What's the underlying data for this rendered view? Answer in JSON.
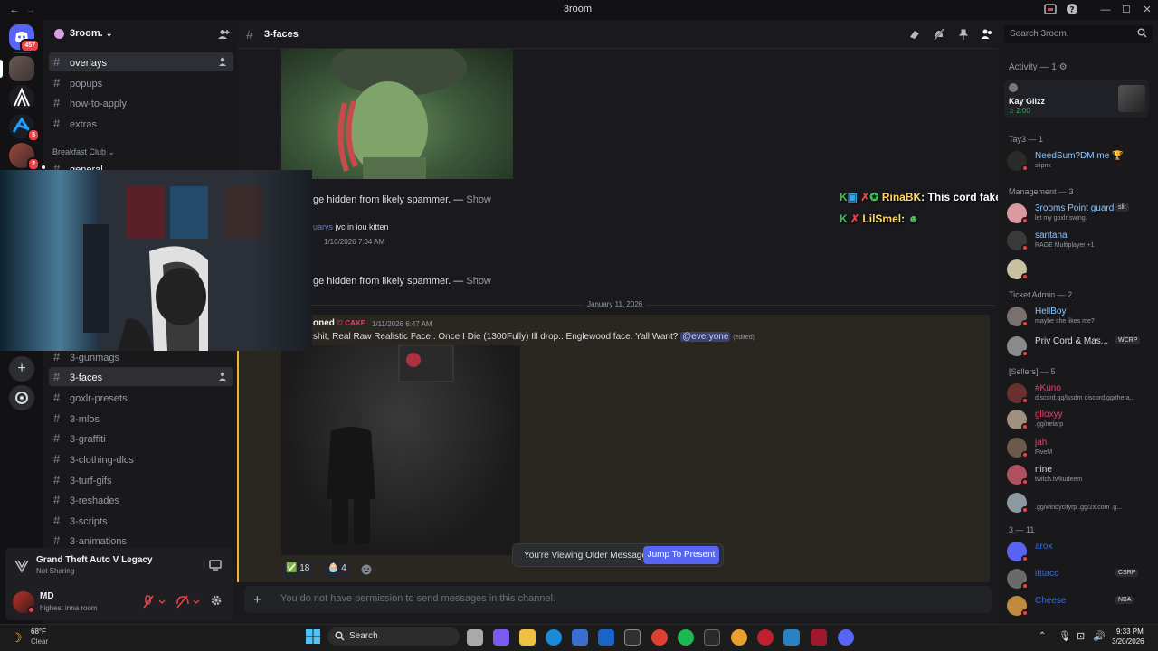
{
  "window": {
    "title": "3room.",
    "nav_back": "←",
    "nav_fwd": "→",
    "min": "—",
    "max": "☐",
    "close": "✕"
  },
  "rail": {
    "home_badge": "457",
    "server_badges": [
      "5",
      "2"
    ]
  },
  "sidebar": {
    "server_name": "3room.",
    "top_channels": [
      {
        "label": "overlays",
        "active": true
      },
      {
        "label": "popups"
      },
      {
        "label": "how-to-apply"
      },
      {
        "label": "extras"
      }
    ],
    "category": "Breakfast Club",
    "category_first": "general",
    "lower_channels": [
      {
        "label": "3-gunmags"
      },
      {
        "label": "3-faces",
        "active": true
      },
      {
        "label": "goxlr-presets"
      },
      {
        "label": "3-mlos"
      },
      {
        "label": "3-graffiti"
      },
      {
        "label": "3-clothing-dlcs"
      },
      {
        "label": "3-turf-gifs"
      },
      {
        "label": "3-reshades"
      },
      {
        "label": "3-scripts"
      },
      {
        "label": "3-animations"
      }
    ],
    "activity": {
      "game": "Grand Theft Auto V Legacy",
      "status": "Not Sharing"
    },
    "user": {
      "name": "MD",
      "status": "highest inna room"
    }
  },
  "header": {
    "channel": "3-faces",
    "search_placeholder": "Search 3room."
  },
  "chat": {
    "hidden_msg_1": "ge hidden from likely spammer. — ",
    "show_1": "Show",
    "reply_user": "uarys",
    "reply_text": "jvc in iou kitten",
    "reply_time": "1/10/2026 7:34 AM",
    "hidden_msg_2": "ge hidden from likely spammer. — ",
    "show_2": "Show",
    "date_divider": "January 11, 2026",
    "msg_author": "oned",
    "msg_tag": "CAKE",
    "msg_time": "1/11/2026 6:47 AM",
    "msg_text": "shit, Real Raw Realistic Face.. Once I Die (1300Fully) Ill drop.. Englewood face. Yall Want? ",
    "msg_mention": "@everyone",
    "msg_edited": "(edited)",
    "reactions": [
      {
        "emoji": "✅",
        "count": "18"
      },
      {
        "emoji": "🧁",
        "count": "4"
      }
    ],
    "older_notice": "You're Viewing Older Messages",
    "jump_label": "Jump To Present",
    "composer_placeholder": "You do not have permission to send messages in this channel."
  },
  "overlay": {
    "line1_name": "RinaBK",
    "line1_text": "This cord fake ass",
    "line2_name": "LilSmel"
  },
  "members": {
    "activity_header": "Activity — 1",
    "activity_user": "Kay Glizz",
    "activity_time": "2:00",
    "groups": [
      {
        "header": "Tay3 — 1",
        "rows": [
          {
            "name": "NeedSum?DM me 🏆",
            "sub": "slipnx",
            "color": "#8ec5ff"
          }
        ]
      },
      {
        "header": "Management — 3",
        "rows": [
          {
            "name": "3rooms Point guard",
            "sub": "let my goxlr swing.",
            "color": "#8ec5ff",
            "tag": "slit"
          },
          {
            "name": "santana",
            "sub": "RAGE Multiplayer +1",
            "color": "#8ec5ff"
          },
          {
            "name": "",
            "sub": "",
            "color": "#8ec5ff"
          }
        ]
      },
      {
        "header": "Ticket Admin — 2",
        "rows": [
          {
            "name": "HellBoy",
            "sub": "maybe she likes me?",
            "color": "#8ec5ff"
          },
          {
            "name": "Priv Cord & Mas...",
            "sub": "",
            "color": "#dbdee1",
            "tag": "WCRP"
          }
        ]
      },
      {
        "header": "[Sellers] — 5",
        "rows": [
          {
            "name": "#Kuno",
            "sub": "discord.gg/lssdm discord.gg/thera...",
            "color": "#e0436b"
          },
          {
            "name": "glloxyy",
            "sub": ".gg/nelarp",
            "color": "#e0436b"
          },
          {
            "name": "jah",
            "sub": "FiveM",
            "color": "#e0436b"
          },
          {
            "name": "nine",
            "sub": "twitch.tv/kudeem",
            "color": "#dbdee1"
          },
          {
            "name": "",
            "sub": ".gg/windycityrp .gg/2x.com .g...",
            "color": "#e0436b"
          }
        ]
      },
      {
        "header": "3 — 11",
        "rows": [
          {
            "name": "arox",
            "sub": "",
            "color": "#3d6bd9"
          },
          {
            "name": "itttacc",
            "sub": "",
            "color": "#3d6bd9",
            "tag": "CSRP"
          },
          {
            "name": "Cheese",
            "sub": "",
            "color": "#3d6bd9",
            "tag": "NBA"
          }
        ]
      }
    ]
  },
  "taskbar": {
    "weather_temp": "68°F",
    "weather_desc": "Clear",
    "search_label": "Search",
    "time": "9:33 PM",
    "date": "3/20/2026"
  },
  "colors": {
    "accent": "#5865f2",
    "danger": "#ed4245",
    "mention_bg": "#3c3a2a"
  }
}
